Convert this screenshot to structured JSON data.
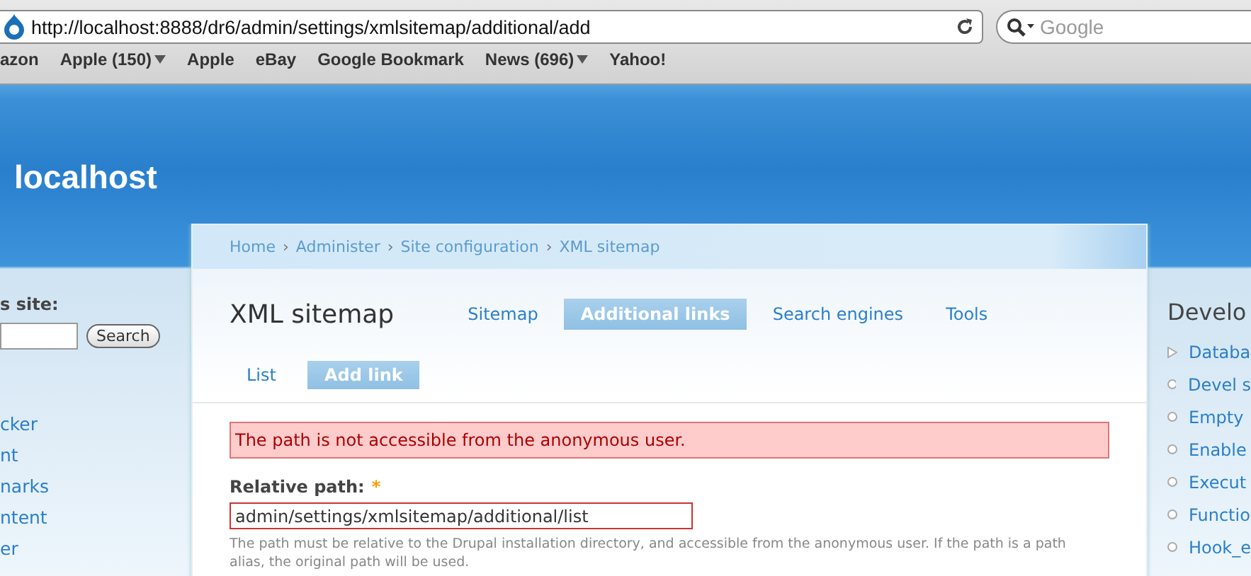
{
  "browser": {
    "address": "http://localhost:8888/dr6/admin/settings/xmlsitemap/additional/add",
    "search": {
      "placeholder": "Google"
    },
    "bookmarks": [
      {
        "label": "azon",
        "kind": "link"
      },
      {
        "label": "Apple (150)",
        "kind": "folder"
      },
      {
        "label": "Apple",
        "kind": "link"
      },
      {
        "label": "eBay",
        "kind": "link"
      },
      {
        "label": "Google Bookmark",
        "kind": "link"
      },
      {
        "label": "News (696)",
        "kind": "folder"
      },
      {
        "label": "Yahoo!",
        "kind": "link"
      }
    ]
  },
  "site_name": "localhost",
  "left_sidebar": {
    "search_label": "s site:",
    "search_button": "Search",
    "links": [
      "cker",
      "nt",
      "narks",
      "ntent",
      "er"
    ]
  },
  "breadcrumb": [
    "Home",
    "Administer",
    "Site configuration",
    "XML sitemap"
  ],
  "breadcrumb_separator": "›",
  "page_title": "XML sitemap",
  "tabs": [
    {
      "label": "Sitemap",
      "selected": false
    },
    {
      "label": "Additional links",
      "selected": true
    },
    {
      "label": "Search engines",
      "selected": false
    },
    {
      "label": "Tools",
      "selected": false
    }
  ],
  "subtabs": [
    {
      "label": "List",
      "selected": false
    },
    {
      "label": "Add link",
      "selected": true
    }
  ],
  "error": "The path is not accessible from the anonymous user.",
  "field": {
    "label": "Relative path:",
    "required": true,
    "required_mark": "*",
    "value": "admin/settings/xmlsitemap/additional/list",
    "error": true,
    "description": "The path must be relative to the Drupal installation directory, and accessible from the anonymous user. If the path is a path alias, the original path will be used."
  },
  "right_sidebar": {
    "title": "Develo",
    "items": [
      {
        "label": "Databa",
        "kind": "collapsed"
      },
      {
        "label": "Devel s",
        "kind": "leaf"
      },
      {
        "label": "Empty",
        "kind": "leaf"
      },
      {
        "label": "Enable",
        "kind": "leaf"
      },
      {
        "label": "Execut",
        "kind": "leaf"
      },
      {
        "label": "Functio",
        "kind": "leaf"
      },
      {
        "label": "Hook_e",
        "kind": "leaf"
      }
    ]
  }
}
